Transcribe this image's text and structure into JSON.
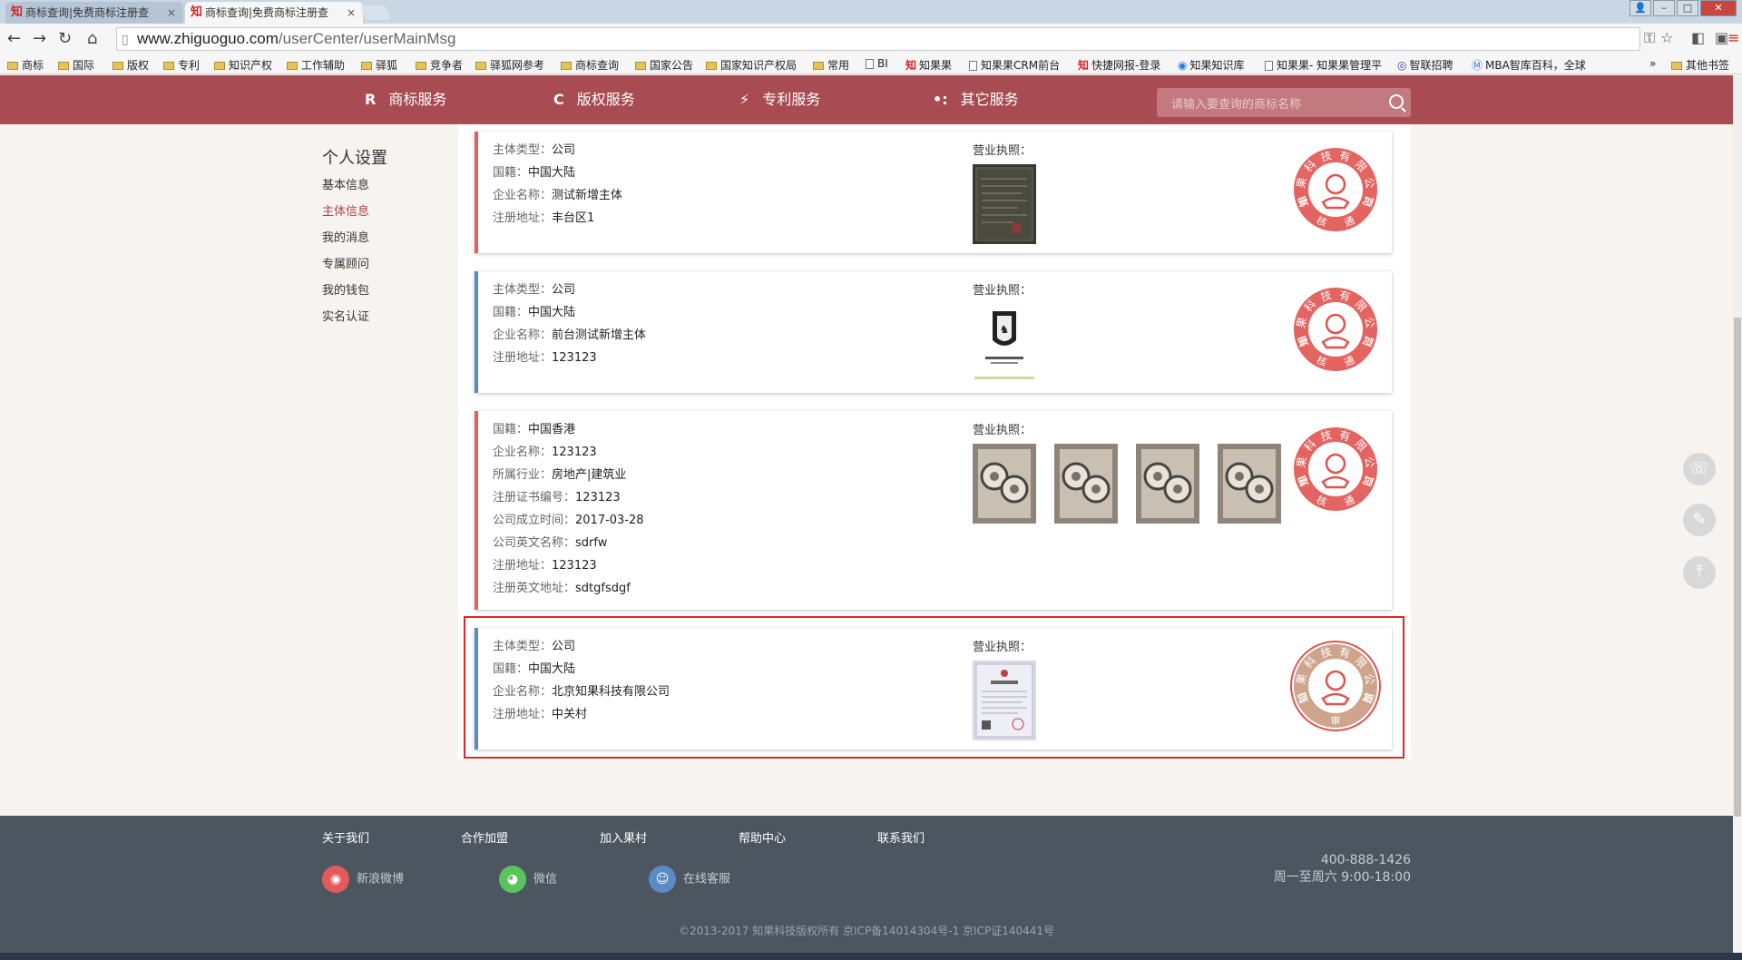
{
  "browser": {
    "tabs": [
      {
        "icon": "知",
        "title": "商标查询|免费商标注册查"
      },
      {
        "icon": "知",
        "title": "商标查询|免费商标注册查"
      }
    ],
    "url_host": "www.zhiguoguo.com",
    "url_path": "/userCenter/userMainMsg",
    "bookmarks": [
      "商标",
      "国际",
      "版权",
      "专利",
      "知识产权",
      "工作辅助",
      "驿狐",
      "竞争者",
      "驿狐网参考",
      "商标查询",
      "国家公告",
      "国家知识产权局",
      "常用",
      "BI",
      "知果果",
      "知果果CRM前台",
      "快捷网报-登录",
      "知果知识库",
      "知果果- 知果果管理平",
      "智联招聘",
      "MBA智库百科，全球",
      "»",
      "其他书签"
    ]
  },
  "nav": {
    "items": [
      {
        "icon": "R",
        "label": "商标服务"
      },
      {
        "icon": "C",
        "label": "版权服务"
      },
      {
        "icon": "⚡",
        "label": "专利服务"
      },
      {
        "icon": "•:",
        "label": "其它服务"
      }
    ],
    "search_placeholder": "请输入要查询的商标名称"
  },
  "sidebar": {
    "title": "个人设置",
    "items": [
      "基本信息",
      "主体信息",
      "我的消息",
      "专属顾问",
      "我的钱包",
      "实名认证"
    ],
    "active_index": 1
  },
  "license_label": "营业执照：",
  "seal": {
    "company_text": "知果科技有限公司",
    "approved_text": "审核通过",
    "reviewing_text": "待审核"
  },
  "cards": [
    {
      "bar_color": "#e06060",
      "status": "approved",
      "fields": [
        {
          "label": "主体类型：",
          "value": "公司"
        },
        {
          "label": "国籍：",
          "value": "中国大陆"
        },
        {
          "label": "企业名称：",
          "value": "测试新增主体"
        },
        {
          "label": "注册地址：",
          "value": "丰台区1"
        }
      ]
    },
    {
      "bar_color": "#5b8ac6",
      "status": "approved",
      "fields": [
        {
          "label": "主体类型：",
          "value": "公司"
        },
        {
          "label": "国籍：",
          "value": "中国大陆"
        },
        {
          "label": "企业名称：",
          "value": "前台测试新增主体"
        },
        {
          "label": "注册地址：",
          "value": "123123"
        }
      ]
    },
    {
      "bar_color": "#e06060",
      "status": "approved",
      "fields": [
        {
          "label": "国籍：",
          "value": "中国香港"
        },
        {
          "label": "企业名称：",
          "value": "123123"
        },
        {
          "label": "所属行业：",
          "value": "房地产|建筑业"
        },
        {
          "label": "注册证书编号：",
          "value": "123123"
        },
        {
          "label": "公司成立时间：",
          "value": "2017-03-28"
        },
        {
          "label": "公司英文名称：",
          "value": "sdrfw"
        },
        {
          "label": "注册地址：",
          "value": "123123"
        },
        {
          "label": "注册英文地址：",
          "value": "sdtgfsdgf"
        }
      ]
    },
    {
      "bar_color": "#5b8ac6",
      "status": "reviewing",
      "fields": [
        {
          "label": "主体类型：",
          "value": "公司"
        },
        {
          "label": "国籍：",
          "value": "中国大陆"
        },
        {
          "label": "企业名称：",
          "value": "北京知果科技有限公司"
        },
        {
          "label": "注册地址：",
          "value": "中关村"
        }
      ]
    }
  ],
  "footer": {
    "links": [
      "关于我们",
      "合作加盟",
      "加入果村",
      "帮助中心",
      "联系我们"
    ],
    "social": [
      {
        "icon": "weibo-icon",
        "label": "新浪微博",
        "color": "#e45a5a"
      },
      {
        "icon": "wechat-icon",
        "label": "微信",
        "color": "#5ac35a"
      },
      {
        "icon": "service-icon",
        "label": "在线客服",
        "color": "#5b8ac6"
      }
    ],
    "phone": "400-888-1426",
    "hours": "周一至周六 9:00-18:00",
    "copyright": "©2013-2017 知果科技版权所有 京ICP备14014304号-1 京ICP证140441号"
  },
  "colors": {
    "brand": "#a84b52",
    "seal_red": "#e0534f",
    "seal_review": "#c99a7f"
  }
}
